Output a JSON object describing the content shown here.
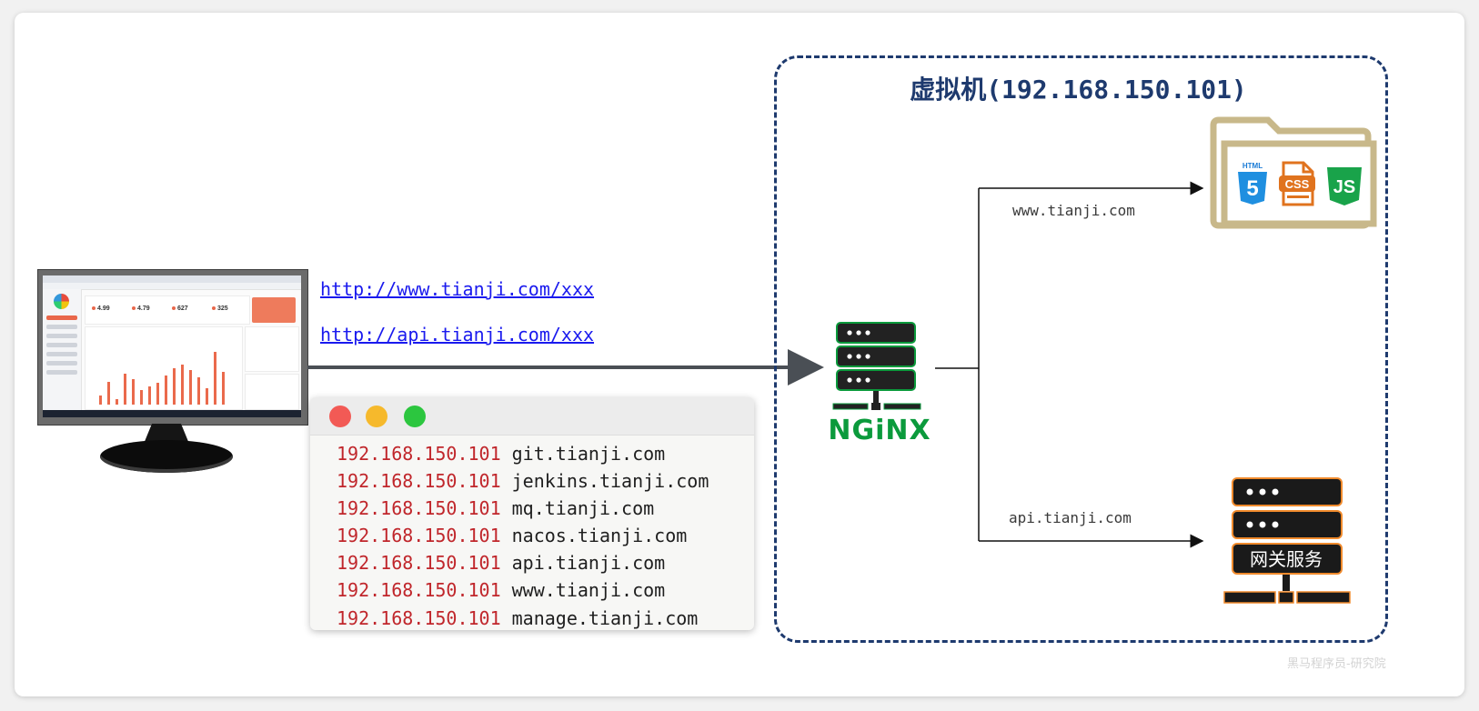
{
  "urls": [
    "http://www.tianji.com/xxx",
    "http://api.tianji.com/xxx"
  ],
  "hosts_file": {
    "entries": [
      {
        "ip": "192.168.150.101",
        "domain": "git.tianji.com"
      },
      {
        "ip": "192.168.150.101",
        "domain": "jenkins.tianji.com"
      },
      {
        "ip": "192.168.150.101",
        "domain": "mq.tianji.com"
      },
      {
        "ip": "192.168.150.101",
        "domain": "nacos.tianji.com"
      },
      {
        "ip": "192.168.150.101",
        "domain": "api.tianji.com"
      },
      {
        "ip": "192.168.150.101",
        "domain": "www.tianji.com"
      },
      {
        "ip": "192.168.150.101",
        "domain": "manage.tianji.com"
      }
    ],
    "window_buttons": {
      "close": "#f25a55",
      "minimize": "#f6b92c",
      "maximize": "#2cc63f"
    }
  },
  "vm": {
    "title": "虚拟机(192.168.150.101)",
    "border_color": "#1e3a6e"
  },
  "nginx": {
    "label": "NGiNX",
    "color": "#0b9a3c"
  },
  "routes": {
    "www_label": "www.tianji.com",
    "api_label": "api.tianji.com"
  },
  "static_files": {
    "html_badge": "HTML",
    "html_number": "5",
    "css_badge": "CSS",
    "js_badge": "JS",
    "folder_color": "#c8b88a"
  },
  "gateway": {
    "label": "网关服务",
    "accent": "#f08a2c"
  },
  "monitor_screen": {
    "stats": [
      "4.99",
      "4.79",
      "627",
      "325"
    ]
  },
  "watermark": "黑马程序员-研究院"
}
